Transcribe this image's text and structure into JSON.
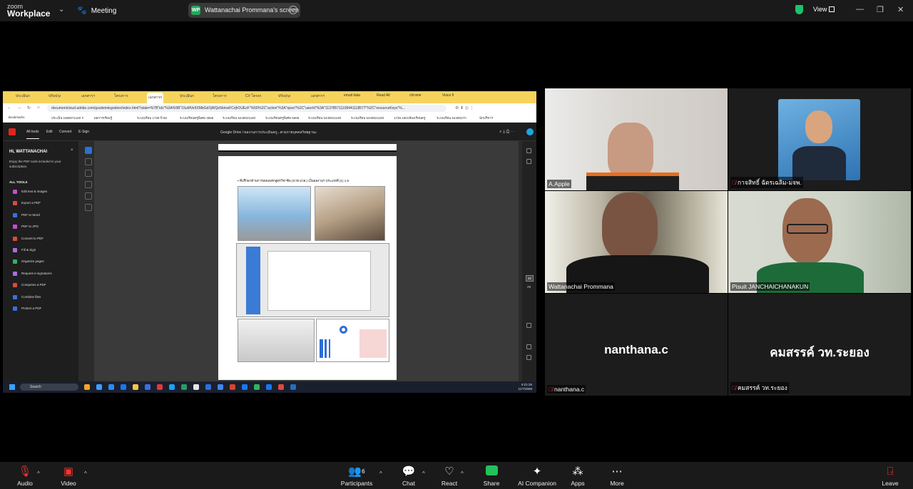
{
  "topbar": {
    "brand_top": "zoom",
    "brand_bottom": "Workplace",
    "meeting_label": "Meeting",
    "share_badge": "WP",
    "share_text": "Wattanachai Prommana's screen",
    "view_label": "View",
    "colors": {
      "secure": "#1ec26a",
      "share_badge": "#26a55c"
    }
  },
  "shared_screen": {
    "browser": {
      "tabs": [
        "ประเมินก",
        "ปรับปรุง",
        "เอกสารฯ",
        "โครงการ",
        "เอกสารก",
        "ประเมินก",
        "โครงการ",
        "CV โครงก",
        "ปรับปรุง",
        "เอกสารฯ",
        "email data",
        "Read All",
        "chrome",
        "Voice fi"
      ],
      "active_tab_index": 4,
      "url": "documentcloud.adobe.com/gsuiteintegration/index.html?state=%7B\"ids\"%3A%5B\"15uMVe5XMbGdXjWQe5btvwFCrjhOUEzF\"%5D%2C\"action\"%3A\"open\"%2C\"userId\"%3A\"113785711109441118577\"%2C\"resourceKeys\"%...",
      "bookmarks": [
        "Bookmarks",
        "ประเมิน 1869071160 ก",
        "ผลการเรียนรู้",
        "ระบบเรียน 1739 ปี 68",
        "ระบบเรียนครูพิเศษ 4856",
        "ระบบเรียน 5449021160",
        "ระบบเรียนครูพิเศษ 5566",
        "ระบบเรียน 5449021160",
        "ระบบเรียน 5449021160",
        "1739.1601ห้องเรียนครู",
        "ระบบเรียน 5449027ก",
        "นักบริหาร"
      ]
    },
    "acrobat": {
      "tabs": [
        "All tools",
        "Edit",
        "Convert",
        "E-Sign"
      ],
      "active_tab_index": 0,
      "doc_path": "Google Drive  /  ผลงานการประเมินครู...ตามรายบุคคลวิทยฐานะ",
      "panel": {
        "greeting": "Hi, WATTANACHAI",
        "close": "×",
        "subtitle": "Enjoy the PDF tools included in your subscription.",
        "section": "ALL TOOLS",
        "tools": [
          {
            "label": "Edit text & images",
            "color": "#c74ad6"
          },
          {
            "label": "Export a PDF",
            "color": "#e0483c"
          },
          {
            "label": "PDF to Word",
            "color": "#3a6fe0"
          },
          {
            "label": "PDF to JPG",
            "color": "#c74ad6"
          },
          {
            "label": "Convert to PDF",
            "color": "#e0483c"
          },
          {
            "label": "Fill & Sign",
            "color": "#a66fe0"
          },
          {
            "label": "Organize pages",
            "color": "#32b35c"
          },
          {
            "label": "Request e-signatures",
            "color": "#a66fe0"
          },
          {
            "label": "Compress a PDF",
            "color": "#e0483c"
          },
          {
            "label": "Combine files",
            "color": "#3a6fe0"
          },
          {
            "label": "Protect a PDF",
            "color": "#3a6fe0"
          }
        ]
      },
      "page_text": "• ที่ปรึกษาด้านการสอนหลักสูตรวิชาชีพ (ปวช.ปวส.) เป็นผลงานฯ ประเภทที่ (1) 1.6",
      "current_page": "22",
      "total_pages": "29"
    },
    "taskbar": {
      "search": "Search",
      "time": "9:21:26",
      "date": "11/7/2568",
      "app_colors": [
        "#f5a623",
        "#3aa0ff",
        "#2d8cf0",
        "#1877f2",
        "#f5c542",
        "#3a6fe0",
        "#e03a3a",
        "#1da1f2",
        "#2a9d5c",
        "#e5e5e5",
        "#2d6fd8",
        "#4285f4",
        "#d6452b",
        "#1877f2",
        "#32b35c",
        "#1877f2",
        "#e0483c",
        "#1f70c1"
      ]
    }
  },
  "participants": [
    {
      "name": "A.Apple",
      "muted": false,
      "mode": "video",
      "bg": "#d8d4cf"
    },
    {
      "name": "กาจสิทธิ์ ฉัตรเฉลิม-มจพ.",
      "muted": true,
      "mode": "photo",
      "bg": "#1b1b1b"
    },
    {
      "name": "Wattanachai Prommana",
      "muted": false,
      "mode": "video",
      "bg": "#6f6a5e",
      "speaking": true
    },
    {
      "name": "Pisuit JANCHAICHANAKUN",
      "muted": false,
      "mode": "video",
      "bg": "#c9cdc3"
    },
    {
      "name": "nanthana.c",
      "muted": true,
      "mode": "name",
      "bg": "#1c1c1c",
      "display": "nanthana.c"
    },
    {
      "name": "คมสรรค์ วท.ระยอง",
      "muted": true,
      "mode": "name",
      "bg": "#1c1c1c",
      "display": "คมสรรค์ วท.ระยอง"
    }
  ],
  "controls": {
    "audio": "Audio",
    "video": "Video",
    "participants": "Participants",
    "participants_count": "6",
    "chat": "Chat",
    "react": "React",
    "share": "Share",
    "ai": "AI Companion",
    "apps": "Apps",
    "more": "More",
    "leave": "Leave"
  }
}
